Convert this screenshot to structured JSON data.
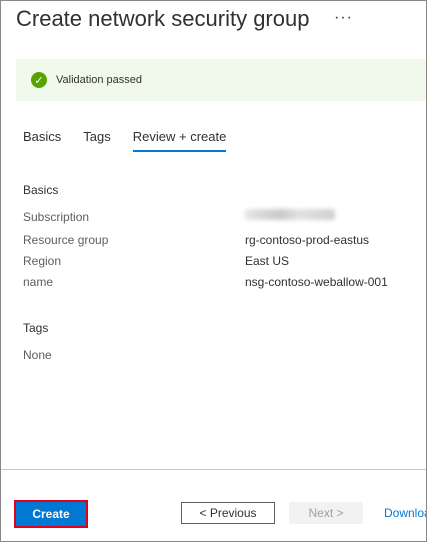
{
  "header": {
    "title": "Create network security group",
    "more_label": "···"
  },
  "validation": {
    "icon": "checkmark-icon",
    "text": "Validation passed",
    "color": "#57a300"
  },
  "tabs": [
    {
      "label": "Basics",
      "active": false
    },
    {
      "label": "Tags",
      "active": false
    },
    {
      "label": "Review + create",
      "active": true
    }
  ],
  "basics": {
    "title": "Basics",
    "rows": [
      {
        "label": "Subscription",
        "value": ""
      },
      {
        "label": "Resource group",
        "value": "rg-contoso-prod-eastus"
      },
      {
        "label": "Region",
        "value": "East US"
      },
      {
        "label": "name",
        "value": "nsg-contoso-weballow-001"
      }
    ]
  },
  "tags": {
    "title": "Tags",
    "value": "None"
  },
  "footer": {
    "create_label": "Create",
    "previous_label": "< Previous",
    "next_label": "Next >",
    "download_label": "Downloa"
  },
  "colors": {
    "accent": "#0078d4",
    "highlight_border": "#e3001b"
  }
}
